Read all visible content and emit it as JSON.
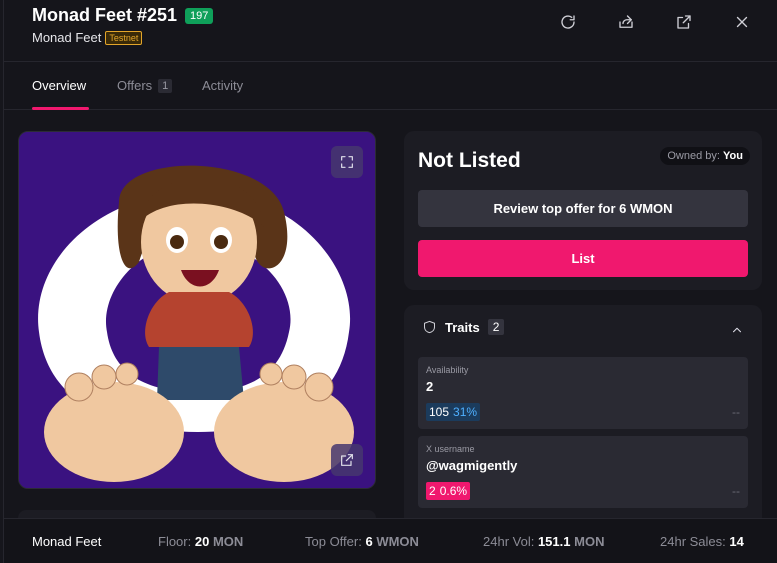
{
  "header": {
    "title": "Monad Feet #251",
    "rank": "197",
    "collection": "Monad Feet",
    "network_badge": "Testnet",
    "icons": [
      "refresh-icon",
      "share-icon",
      "external-link-icon",
      "close-icon"
    ]
  },
  "tabs": [
    {
      "label": "Overview",
      "active": true
    },
    {
      "label": "Offers",
      "count": "1"
    },
    {
      "label": "Activity"
    }
  ],
  "listing": {
    "status": "Not Listed",
    "owned_by_label": "Owned by:",
    "owned_by_value": "You",
    "review_offer_label": "Review top offer for 6 WMON",
    "list_label": "List"
  },
  "traits": {
    "title": "Traits",
    "count": "2",
    "items": [
      {
        "type": "Availability",
        "value": "2",
        "count": "105",
        "pct": "31%",
        "price": "--"
      },
      {
        "type": "X username",
        "value": "@wagmigently",
        "count": "2",
        "pct": "0.6%",
        "price": "--"
      }
    ]
  },
  "footer": {
    "collection": "Monad Feet",
    "floor_label": "Floor:",
    "floor_value": "20",
    "floor_unit": "MON",
    "top_offer_label": "Top Offer:",
    "top_offer_value": "6",
    "top_offer_unit": "WMON",
    "vol_label": "24hr Vol:",
    "vol_value": "151.1",
    "vol_unit": "MON",
    "sales_label": "24hr Sales:",
    "sales_value": "14"
  },
  "colors": {
    "accent": "#f0186e",
    "rank_badge": "#0fa05a",
    "testnet": "#e3a52a",
    "image_bg": "#3a1280"
  }
}
